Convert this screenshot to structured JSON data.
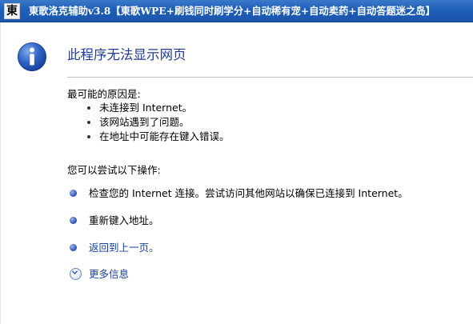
{
  "window": {
    "app_icon_char": "東",
    "title": "東歌洛克辅助v3.8【東歌WPE+刷钱同时刷学分+自动稀有宠+自动卖药+自动答题迷之岛】"
  },
  "error_page": {
    "title": "此程序无法显示网页",
    "reasons_heading": "最可能的原因是:",
    "reasons": [
      "未连接到 Internet。",
      "该网站遇到了问题。",
      "在地址中可能存在键入错误。"
    ],
    "actions_heading": "您可以尝试以下操作:",
    "actions": [
      "检查您的 Internet 连接。尝试访问其他网站以确保已连接到 Internet。",
      "重新键入地址。",
      "返回到上一页。"
    ],
    "more_info": "更多信息"
  },
  "colors": {
    "titlebar": "#1f5fb8",
    "title_text": "#ffffff",
    "heading_blue": "#1f3a93",
    "link_blue": "#1a3fa0"
  }
}
